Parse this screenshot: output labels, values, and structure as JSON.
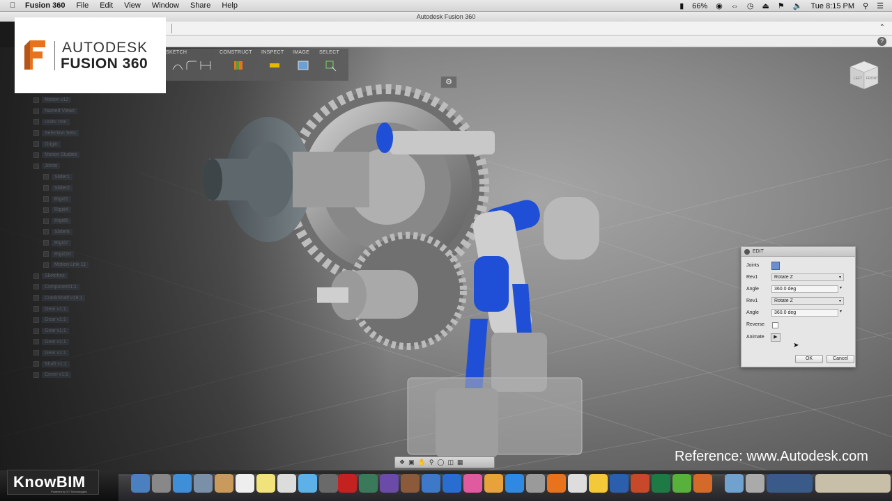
{
  "menubar": {
    "apple": "",
    "items": [
      "Fusion 360",
      "File",
      "Edit",
      "View",
      "Window",
      "Share",
      "Help"
    ],
    "battery": "66%",
    "clock": "Tue 8:15 PM"
  },
  "window": {
    "title": "Autodesk Fusion 360"
  },
  "ribbon": {
    "groups": [
      "SKETCH",
      "CONSTRUCT",
      "INSPECT",
      "IMAGE",
      "SELECT"
    ]
  },
  "browser_tree": {
    "rows": [
      "Motion v12",
      "Named Views",
      "Units: mm",
      "Selection Sets",
      "Origin",
      "Motion Studies",
      "Joints",
      "Slider1",
      "Slider2",
      "Rigid1",
      "Rigid4",
      "Rigid5",
      "Slider6",
      "Rigid7",
      "Rigid10",
      "Motion Link 11",
      "Sketches",
      "Component1:1",
      "CrankShaft v19:1",
      "Gear v1:1",
      "Gear v1:1",
      "Gear v1:1",
      "Gear v1:1",
      "Gear v1:1",
      "Shaft v1:1",
      "Cover v1:1"
    ]
  },
  "viewcube": {
    "front": "FRONT",
    "left": "LEFT"
  },
  "edit_dialog": {
    "title": "EDIT",
    "joints_label": "Joints",
    "rev1_label": "Rev1",
    "rev1_value": "Rotate Z",
    "angle1_label": "Angle",
    "angle1_value": "360.0 deg",
    "rev2_label": "Rev1",
    "rev2_value": "Rotate Z",
    "angle2_label": "Angle",
    "angle2_value": "360.0 deg",
    "reverse_label": "Reverse",
    "animate_label": "Animate",
    "ok": "OK",
    "cancel": "Cancel"
  },
  "overlay": {
    "brand_line1": "AUTODESK",
    "brand_line2": "FUSION 360",
    "knowbim": "KnowBIM",
    "knowbim_sub": "Powered by ST Technologies",
    "reference": "Reference: www.Autodesk.com"
  },
  "colors": {
    "autodesk_orange": "#e8731c",
    "joint_blue": "#1f4fd6",
    "dialog_bg": "#e6e6e6"
  }
}
